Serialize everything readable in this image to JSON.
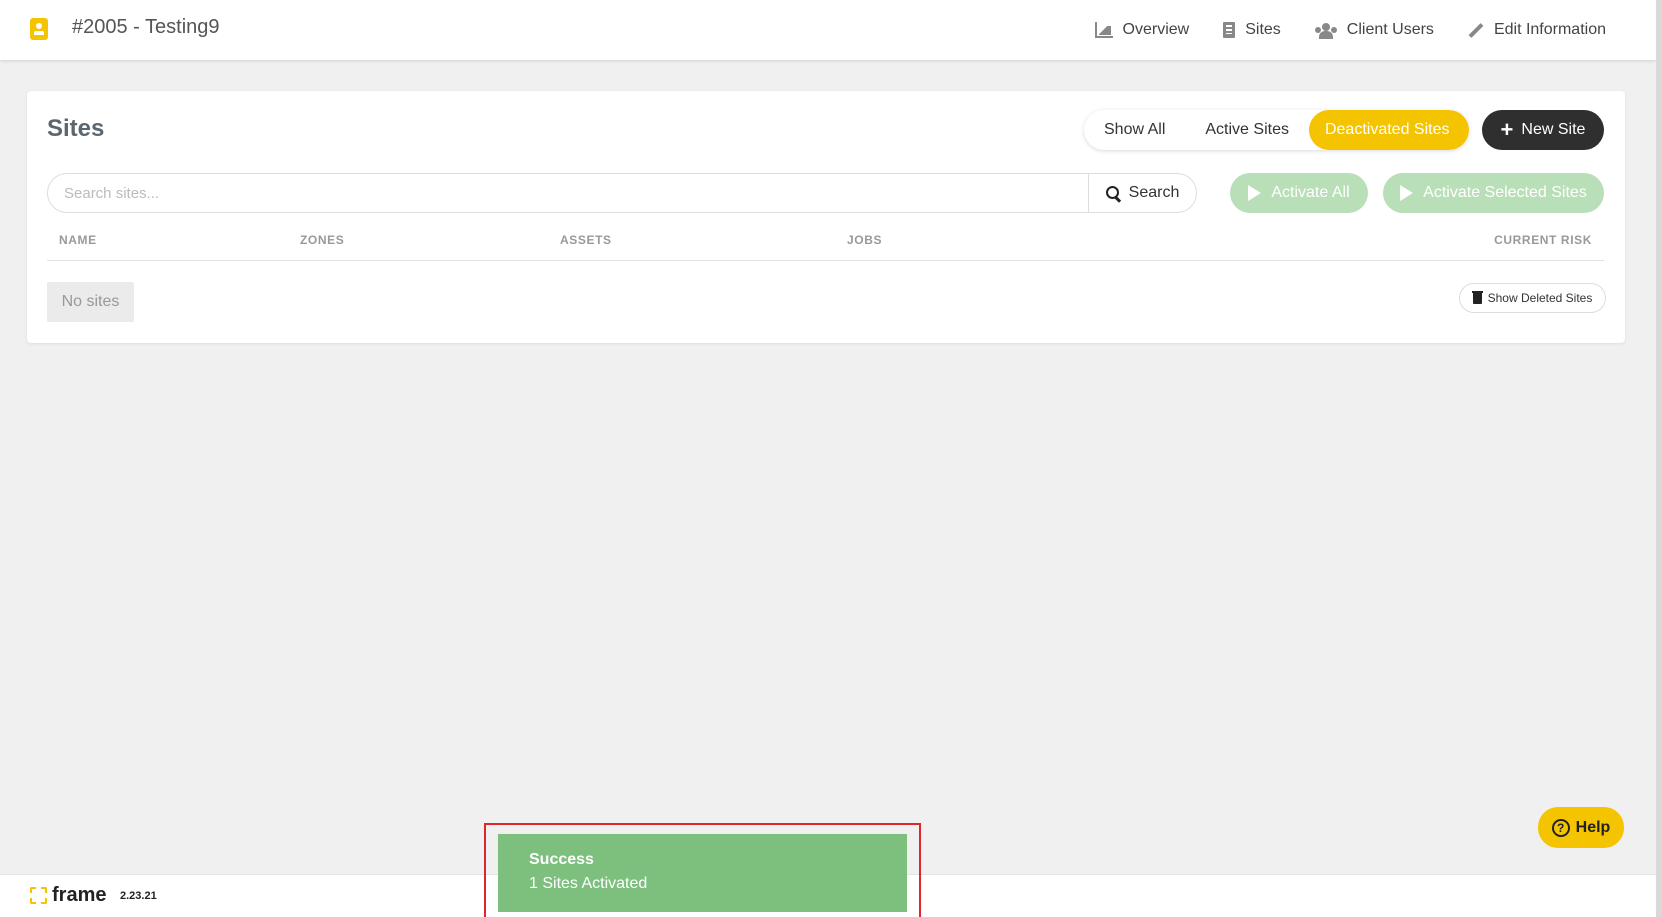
{
  "header": {
    "title": "#2005 - Testing9",
    "nav": [
      {
        "label": "Overview",
        "icon": "chart-icon"
      },
      {
        "label": "Sites",
        "icon": "building-icon"
      },
      {
        "label": "Client Users",
        "icon": "users-icon"
      },
      {
        "label": "Edit Information",
        "icon": "pencil-icon"
      }
    ]
  },
  "sites": {
    "title": "Sites",
    "filters": [
      "Show All",
      "Active Sites",
      "Deactivated Sites"
    ],
    "active_filter": "Deactivated Sites",
    "new_site_label": "New Site",
    "search_placeholder": "Search sites...",
    "search_button": "Search",
    "activate_all": "Activate All",
    "activate_selected": "Activate Selected Sites",
    "columns": [
      "NAME",
      "ZONES",
      "ASSETS",
      "JOBS",
      "CURRENT RISK"
    ],
    "empty_text": "No sites",
    "show_deleted": "Show Deleted Sites"
  },
  "help_label": "Help",
  "footer": {
    "brand": "frame",
    "version": "2.23.21"
  },
  "toast": {
    "title": "Success",
    "message": "1 Sites Activated"
  },
  "colors": {
    "accent": "#f5c400",
    "success": "#7dc07d",
    "dark": "#2f2f2f",
    "highlight": "#e0252d"
  }
}
